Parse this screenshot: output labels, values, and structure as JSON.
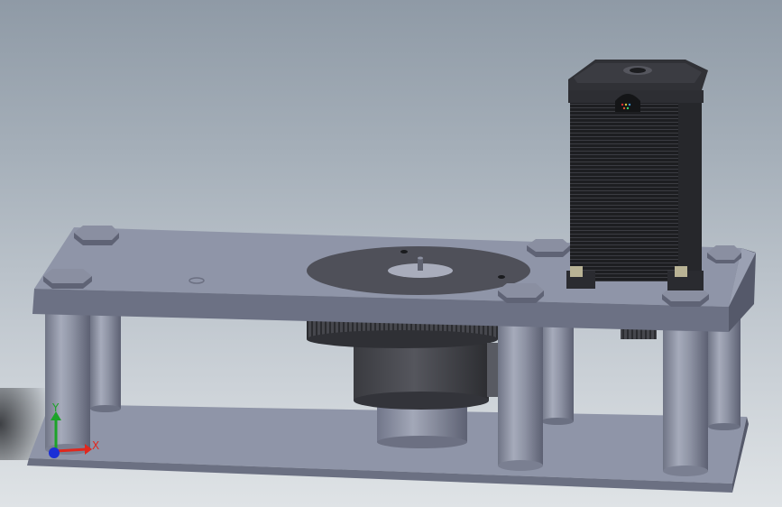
{
  "viewport": {
    "background_top": "#8f9aa6",
    "background_bottom": "#dfe3e6"
  },
  "colors": {
    "plate_top": "#8f95a8",
    "plate_front": "#6c7184",
    "plate_side": "#55596a",
    "disk": "#4e4f58",
    "motor_body": "#1f2023",
    "gear": "#3f4046",
    "standoff": "#8c91a2"
  },
  "triad": {
    "x_label": "X",
    "y_label": "Y",
    "x_color": "#e0281e",
    "y_color": "#1ca328",
    "z_color": "#1b2fd6"
  },
  "icons": {
    "triad": "coordinate-triad-icon"
  }
}
